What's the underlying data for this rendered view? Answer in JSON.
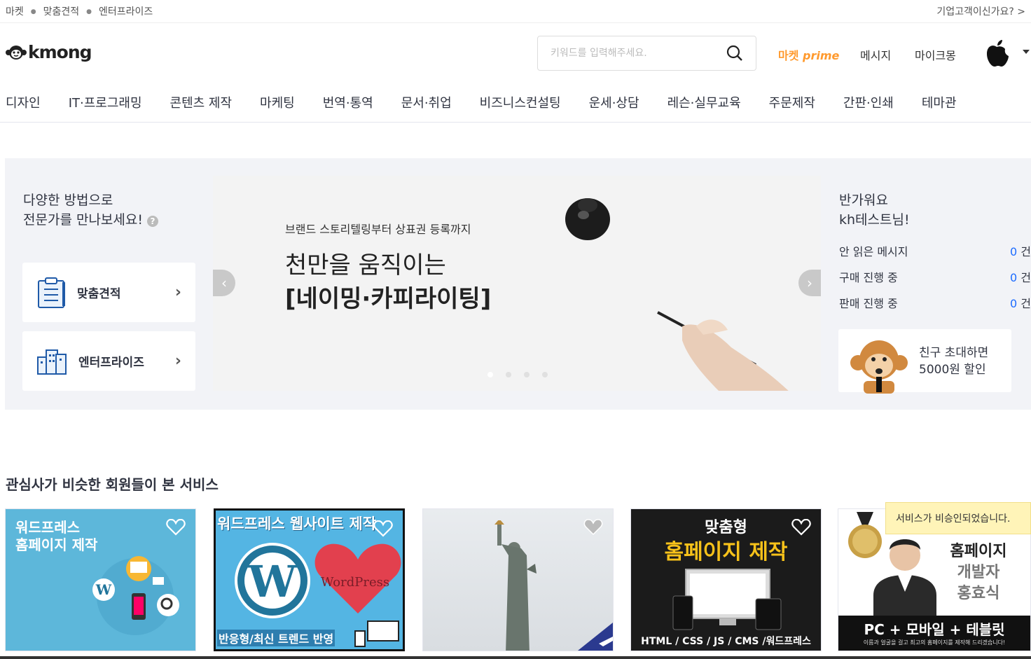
{
  "topbar": {
    "crumbs": [
      "마켓",
      "맞춤견적",
      "엔터프라이즈"
    ],
    "right": "기업고객이신가요?"
  },
  "header": {
    "logo_text": "kmong",
    "search_placeholder": "키워드를 입력해주세요.",
    "market_prime_a": "마켓",
    "market_prime_b": "prime",
    "messages": "메시지",
    "mykmong": "마이크몽"
  },
  "gnb": [
    "디자인",
    "IT·프로그래밍",
    "콘텐츠 제작",
    "마케팅",
    "번역·통역",
    "문서·취업",
    "비즈니스컨설팅",
    "운세·상담",
    "레슨·실무교육",
    "주문제작",
    "간판·인쇄",
    "테마관"
  ],
  "hero": {
    "left_title_1": "다양한 방법으로",
    "left_title_2": "전문가를 만나보세요!",
    "card1": "맞춤견적",
    "card2": "엔터프라이즈",
    "banner_sub": "브랜드 스토리텔링부터 상표권 등록까지",
    "banner_title_1": "천만을 움직이는",
    "banner_title_2": "[네이밍·카피라이팅]",
    "greet_1": "반가워요",
    "greet_2": "kh테스트님!",
    "stats": [
      {
        "label": "안 읽은 메시지",
        "num": "0",
        "unit": "건"
      },
      {
        "label": "구매 진행 중",
        "num": "0",
        "unit": "건"
      },
      {
        "label": "판매 진행 중",
        "num": "0",
        "unit": "건"
      }
    ],
    "invite_1": "친구 초대하면",
    "invite_2": "5000원 할인"
  },
  "section_title": "관심사가 비슷한 회원들이 본 서비스",
  "thumbs": {
    "t1_l1": "워드프레스",
    "t1_l2": "홈페이지 제작",
    "t2_top": "워드프레스 웹사이트 제작",
    "t2_wp": "WordPress",
    "t2_bottom": "반응형/최신 트렌드 반영",
    "t4_l1": "맞춤형",
    "t4_l2": "홈페이지 제작",
    "t4_bottom": "HTML / CSS / JS / CMS /워드프레스",
    "t5_l1": "홈페이지",
    "t5_l2": "개발자",
    "t5_l3": "홍효식",
    "t5_bottom": "PC + 모바일 + 테블릿",
    "t5_small": "이름과 얼굴을 걸고 최고의 홈페이지를 제작해 드리겠습니다!"
  },
  "toast": "서비스가 비승인되었습니다.",
  "colors": {
    "accent": "#ffd400",
    "blue": "#1d6cff",
    "prime": "#ff9a2e"
  }
}
